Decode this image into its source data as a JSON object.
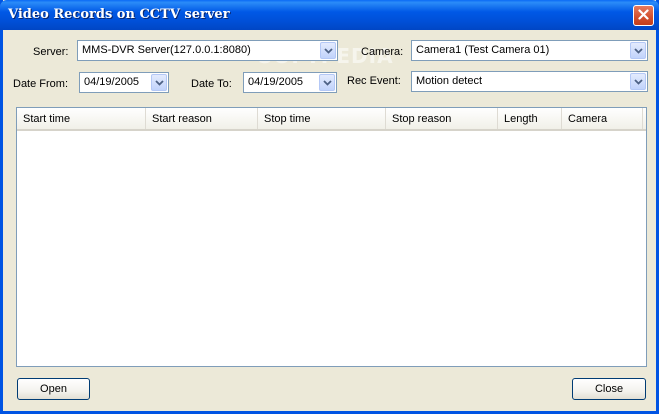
{
  "window": {
    "title": "Video Records on CCTV server"
  },
  "filters": {
    "server_label": "Server:",
    "server_value": "MMS-DVR Server(127.0.0.1:8080)",
    "camera_label": "Camera:",
    "camera_value": "Camera1 (Test Camera 01)",
    "date_from_label": "Date From:",
    "date_from_value": "04/19/2005",
    "date_to_label": "Date To:",
    "date_to_value": "04/19/2005",
    "rec_event_label": "Rec Event:",
    "rec_event_value": "Motion detect"
  },
  "table": {
    "columns": [
      "Start time",
      "Start reason",
      "Stop time",
      "Stop reason",
      "Length",
      "Camera"
    ],
    "rows": []
  },
  "buttons": {
    "open": "Open",
    "close": "Close"
  },
  "watermark": "SOFTPEDIA",
  "icons": {
    "close": "close-x-icon",
    "dropdown": "chevron-down-icon"
  },
  "colors": {
    "titlebar": "#0054e3",
    "close_button": "#d24f2d",
    "face": "#ece9d8"
  }
}
